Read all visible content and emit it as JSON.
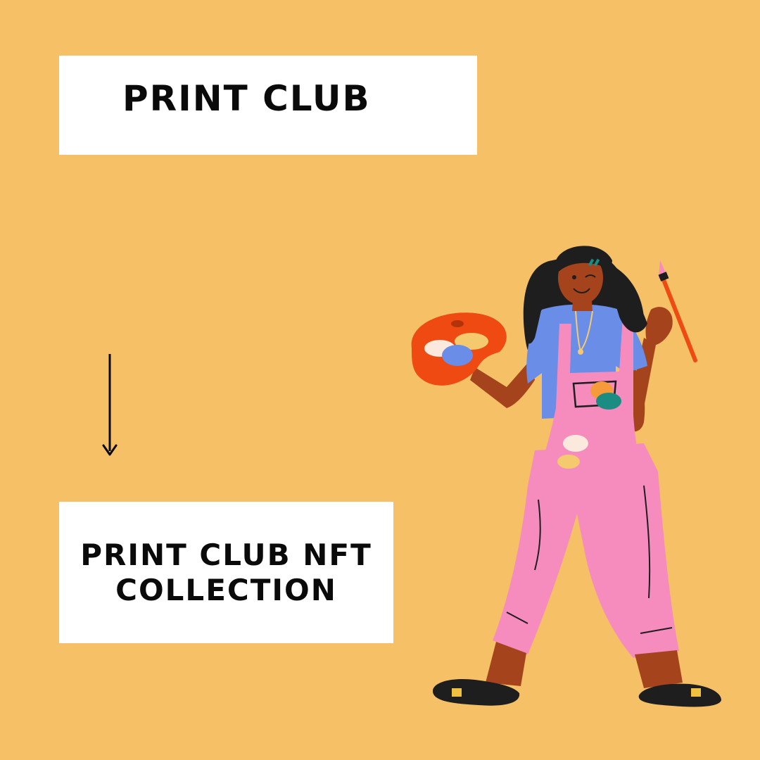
{
  "top_card": {
    "title": "PRINT CLUB"
  },
  "bottom_card": {
    "title": "PRINT CLUB NFT COLLECTION"
  },
  "icons": {
    "arrow": "arrow-down-icon",
    "illustration": "painter-illustration"
  },
  "colors": {
    "background": "#F6C066",
    "card": "#FFFFFF",
    "text": "#0A0A0A",
    "overalls": "#F68BBE",
    "shirt": "#6A8DE8",
    "skin": "#A5441C",
    "hair": "#1E1E1E",
    "palette": "#EF4A12"
  }
}
